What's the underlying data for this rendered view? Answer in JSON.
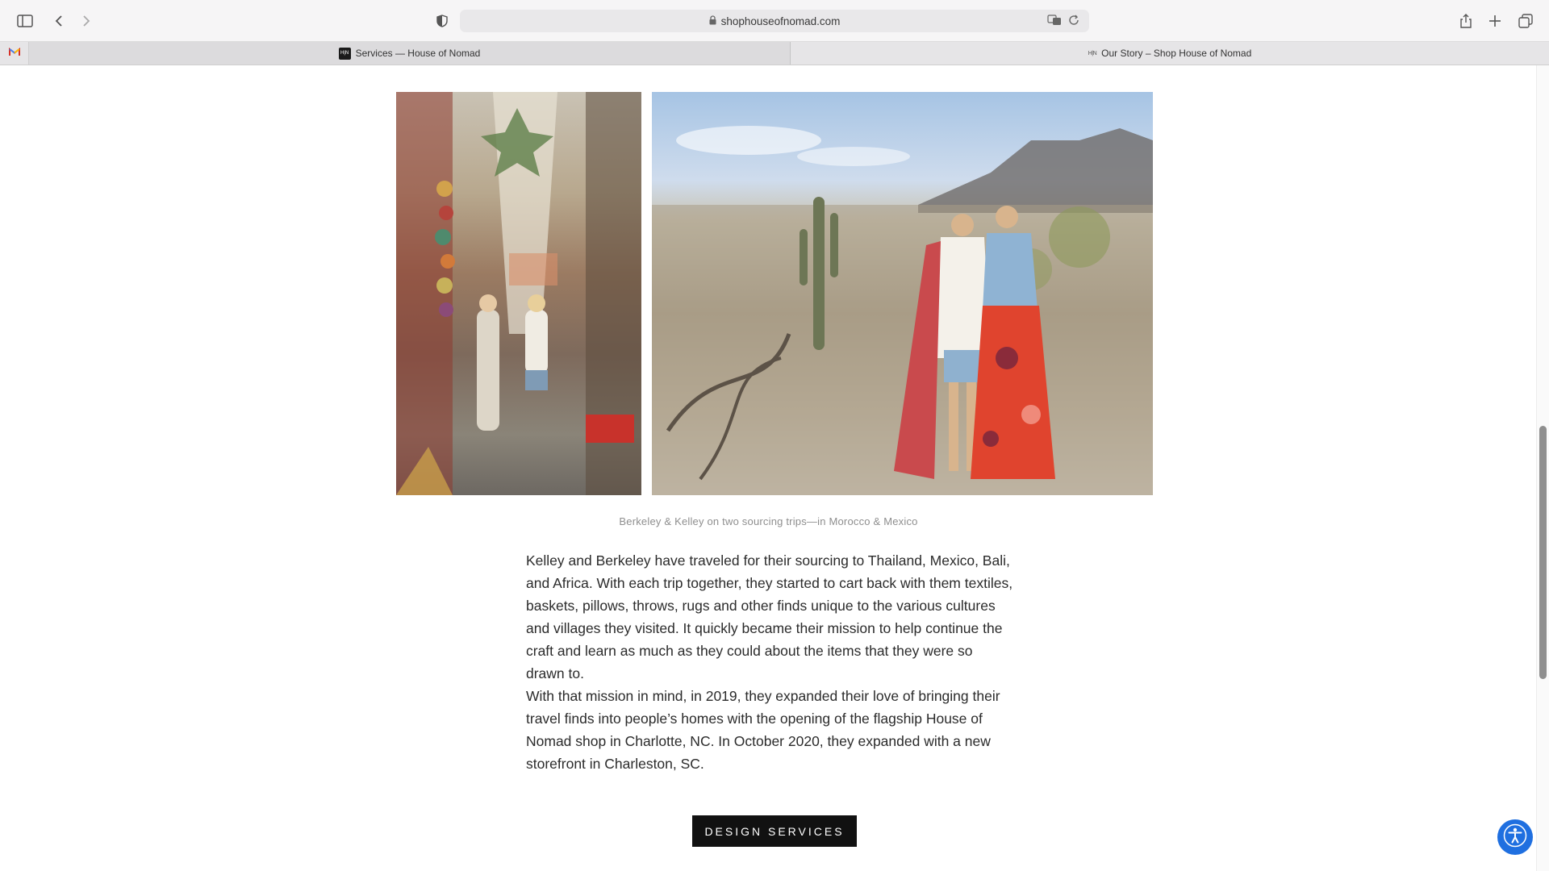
{
  "browser": {
    "url": "shophouseofnomad.com",
    "tabs": [
      {
        "label": "Services — House of Nomad",
        "favicon": "house-of-nomad-favicon"
      },
      {
        "label": "Our Story – Shop House of Nomad",
        "favicon": "house-of-nomad-favicon"
      }
    ],
    "pinned_tab": {
      "icon": "gmail-icon"
    }
  },
  "page": {
    "images": [
      {
        "name": "market-photo",
        "depicts": "two women walking through a market street"
      },
      {
        "name": "desert-photo",
        "depicts": "two women standing in a desert with cacti"
      }
    ],
    "caption": "Berkeley & Kelley on two sourcing trips—in Morocco & Mexico",
    "paragraphs": [
      "Kelley and Berkeley have traveled for their sourcing to Thailand, Mexico, Bali, and Africa. With each trip together, they started to cart back with them textiles, baskets, pillows, throws, rugs and other finds unique to the various cultures and villages they visited. It quickly became their mission to help continue the craft and learn as much as they could about the items that they were so drawn to.",
      "With that mission in mind, in 2019, they expanded their love of bringing their travel finds into people’s homes with the opening of the flagship House of Nomad shop in Charlotte, NC. In October 2020, they expanded with a new storefront in Charleston, SC."
    ],
    "cta_label": "DESIGN SERVICES"
  },
  "colors": {
    "cta_bg": "#111111",
    "accessibility_button": "#1f6fe0",
    "caption_text": "#8e8e8e"
  }
}
